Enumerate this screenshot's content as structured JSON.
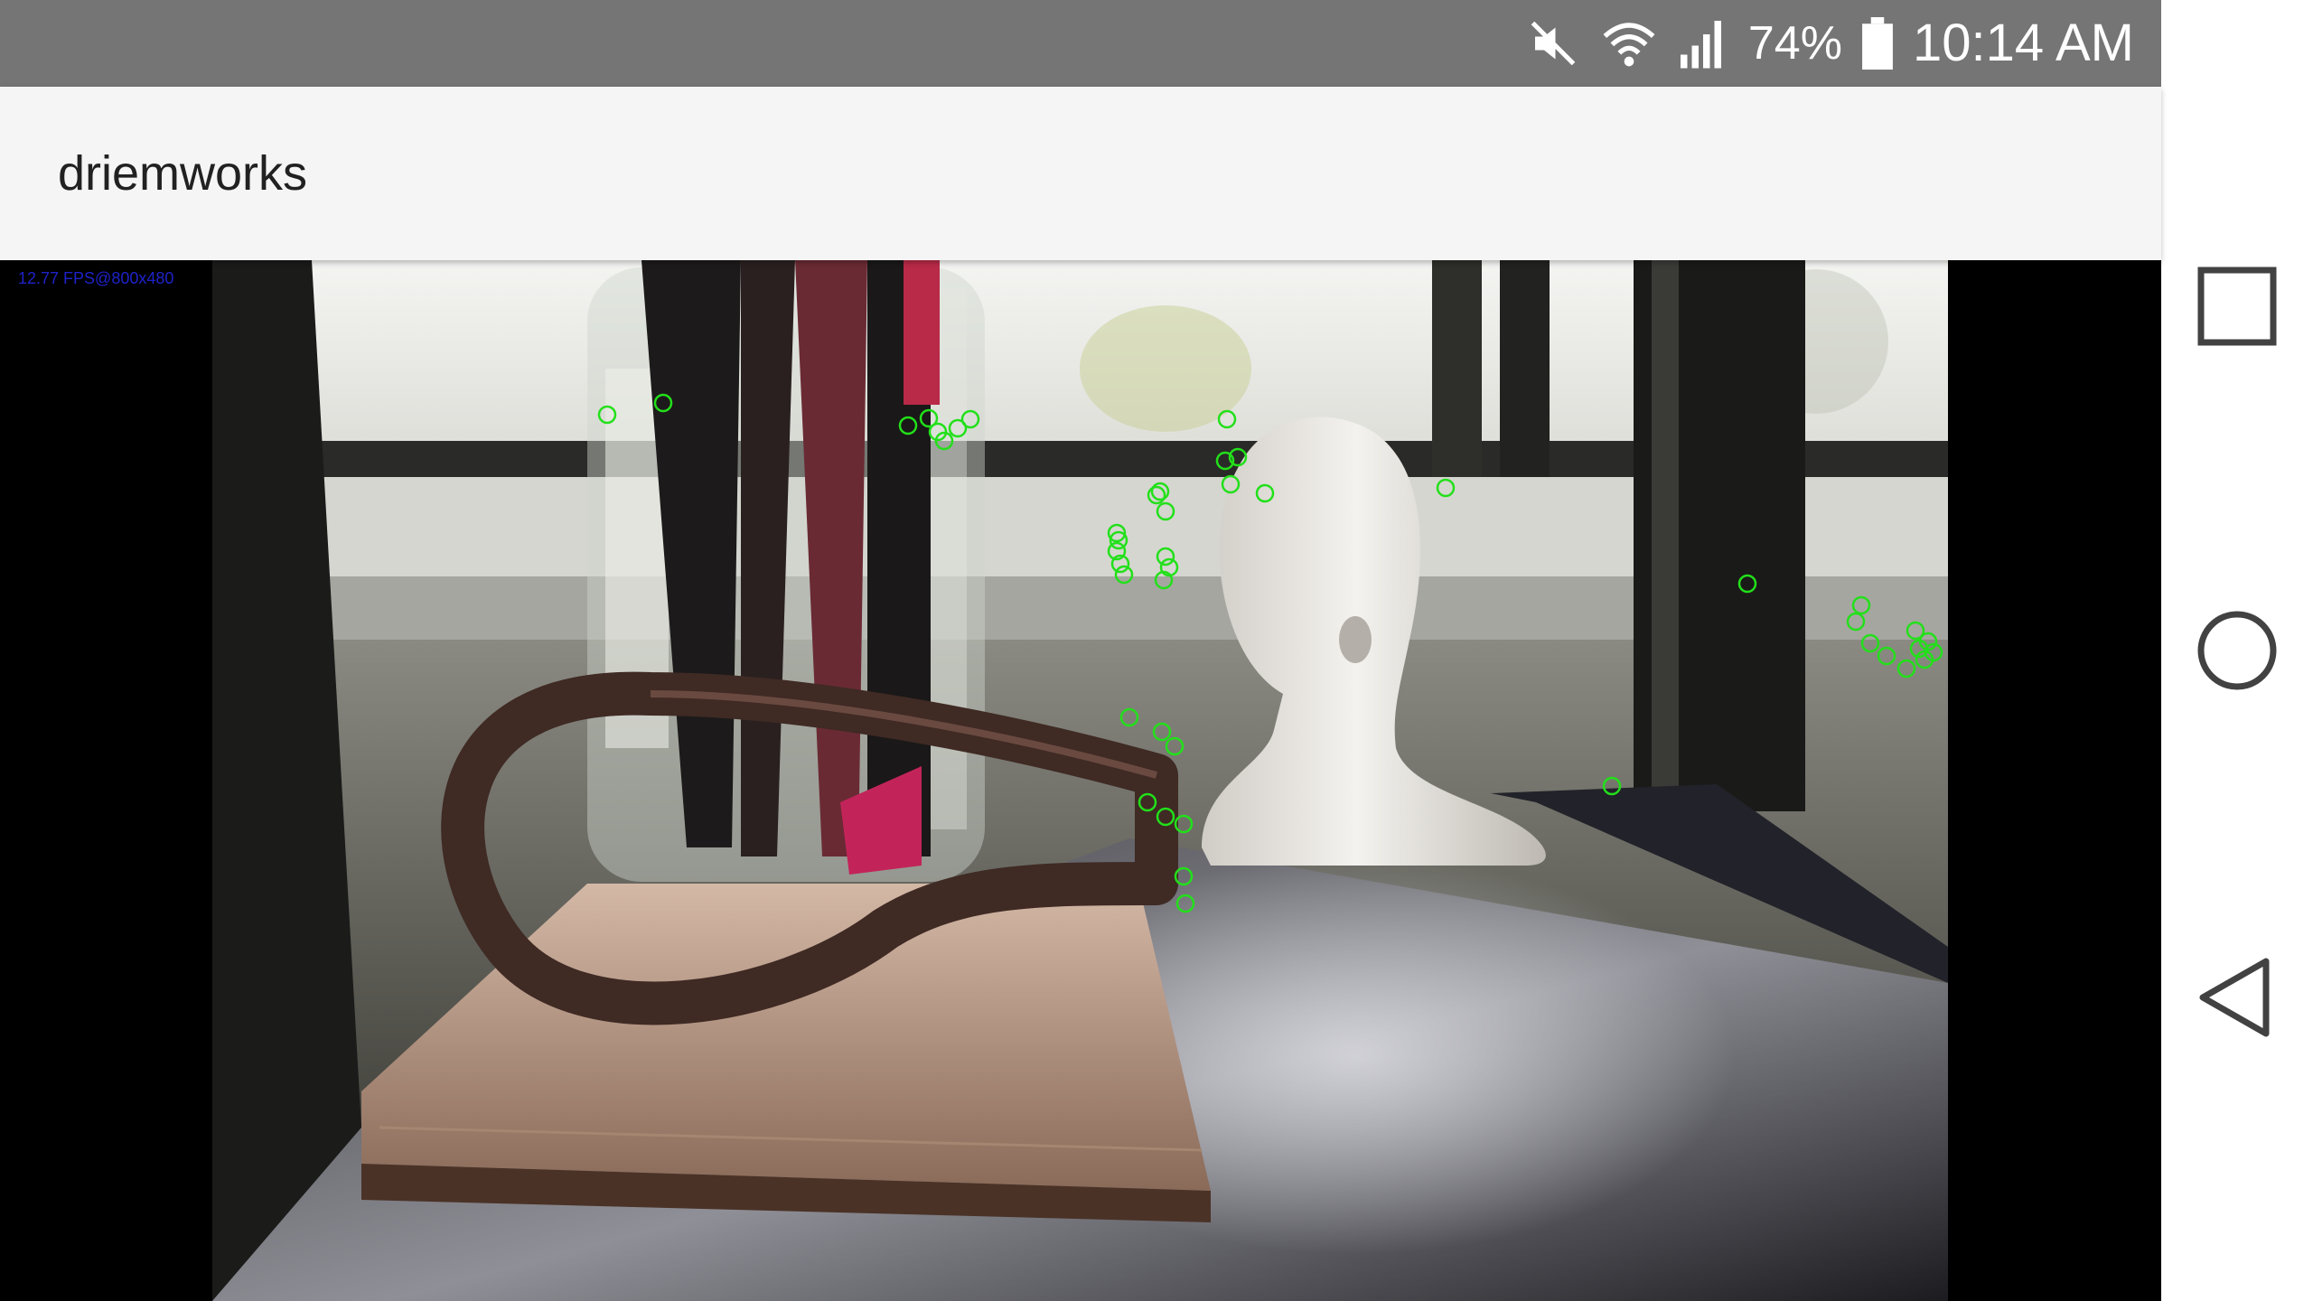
{
  "status_bar": {
    "battery_percent": "74%",
    "time": "10:14 AM",
    "icons": [
      "mute-icon",
      "wifi-icon",
      "cell-signal-icon",
      "battery-icon"
    ]
  },
  "app_bar": {
    "title": "driemworks"
  },
  "camera": {
    "fps_text": "12.77 FPS@800x480",
    "keypoint_color": "#22e01a"
  },
  "nav_bar": {
    "buttons": [
      "recents-icon",
      "home-icon",
      "back-icon"
    ]
  }
}
